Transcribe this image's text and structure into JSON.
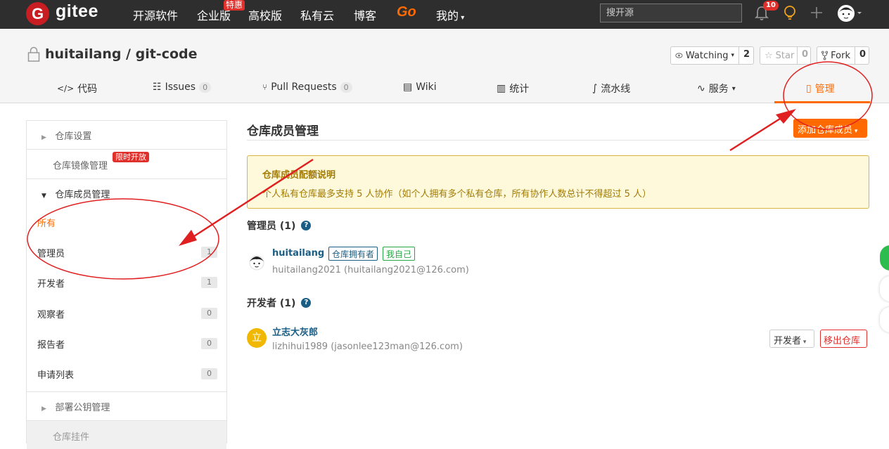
{
  "topnav": {
    "logo_letter": "G",
    "logo_text": "gitee",
    "items": [
      "开源软件",
      "企业版",
      "高校版",
      "私有云",
      "博客"
    ],
    "enterprise_badge": "特惠",
    "go": "Go",
    "mine": "我的",
    "search_placeholder": "搜开源",
    "notifications": "10"
  },
  "repo": {
    "title": "huitailang / git-code",
    "watch": {
      "label": "Watching",
      "count": "2"
    },
    "star": {
      "label": "Star",
      "count": "0"
    },
    "fork": {
      "label": "Fork",
      "count": "0"
    },
    "tabs": {
      "code": "代码",
      "issues": "Issues",
      "issues_count": "0",
      "prs": "Pull Requests",
      "prs_count": "0",
      "wiki": "Wiki",
      "stats": "统计",
      "pipeline": "流水线",
      "service": "服务",
      "manage": "管理"
    }
  },
  "sidebar": {
    "repo_settings": "仓库设置",
    "mirror": "仓库镜像管理",
    "mirror_badge": "限时开放",
    "members": "仓库成员管理",
    "all": "所有",
    "admins": "管理员",
    "admins_count": "1",
    "devs": "开发者",
    "devs_count": "1",
    "observers": "观察者",
    "observers_count": "0",
    "reporters": "报告者",
    "reporters_count": "0",
    "requests": "申请列表",
    "requests_count": "0",
    "deploy_keys": "部署公钥管理",
    "hooks": "仓库挂件"
  },
  "main": {
    "title": "仓库成员管理",
    "add_button": "添加仓库成员",
    "notice_title": "仓库成员配额说明",
    "notice_text": "个人私有仓库最多支持 5 人协作（如个人拥有多个私有仓库，所有协作人数总计不得超过 5 人）",
    "admins_heading": "管理员 (1)",
    "devs_heading": "开发者 (1)",
    "admin": {
      "name": "huitailang",
      "tag_owner": "仓库拥有者",
      "tag_self": "我自己",
      "sub": "huitailang2021 (huitailang2021@126.com)"
    },
    "dev": {
      "avatar_letter": "立",
      "name": "立志大灰郎",
      "sub": "lizhihui1989 (jasonlee123man@126.com)",
      "role": "开发者",
      "remove": "移出仓库"
    }
  },
  "colors": {
    "brand_red": "#c71d23",
    "accent_orange": "#ff6a00",
    "link_blue": "#1b5e85",
    "annotation_red": "#e02020"
  }
}
